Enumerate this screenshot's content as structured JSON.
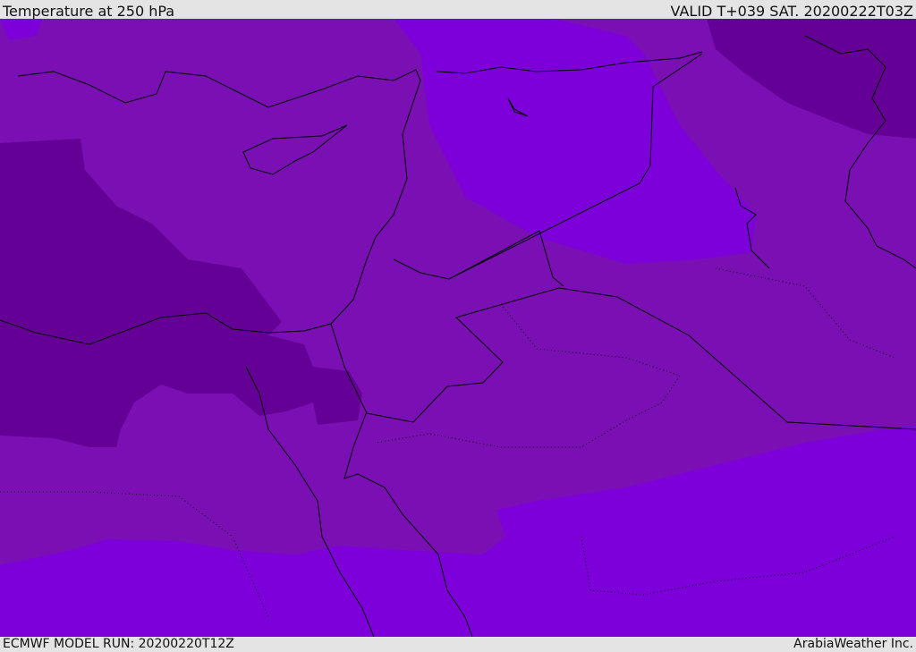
{
  "header": {
    "title": "Temperature at 250 hPa",
    "valid": "VALID T+039 SAT. 20200222T03Z"
  },
  "footer": {
    "model_run": "ECMWF MODEL RUN: 20200220T12Z",
    "credit": "ArabiaWeather Inc."
  },
  "colors": {
    "medium": "#7a10b4",
    "warm": "#7d00da",
    "cold": "#650096",
    "background": "#e4e4e4"
  }
}
